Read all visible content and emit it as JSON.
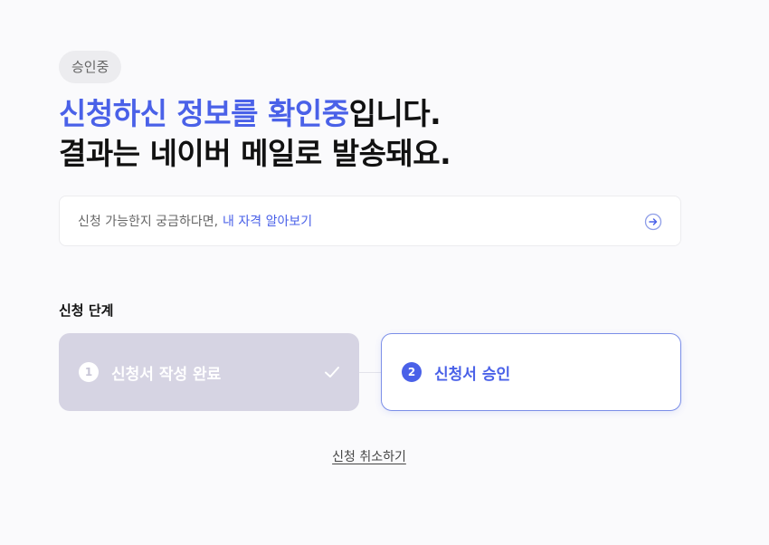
{
  "status_badge": "승인중",
  "headline": {
    "accent": "신청하신 정보를 확인중",
    "rest": "입니다.",
    "line2": "결과는 네이버 메일로 발송돼요."
  },
  "info": {
    "text": "신청 가능한지 궁금하다면,",
    "link": "내 자격 알아보기",
    "icon": "arrow-right-circle-icon"
  },
  "steps": {
    "title": "신청 단계",
    "items": [
      {
        "number": "1",
        "label": "신청서 작성 완료",
        "state": "done"
      },
      {
        "number": "2",
        "label": "신청서 승인",
        "state": "current"
      }
    ]
  },
  "cancel_label": "신청 취소하기",
  "colors": {
    "accent": "#4a61e8",
    "done_step_bg": "#d6d4e3",
    "badge_bg": "#ececef"
  }
}
